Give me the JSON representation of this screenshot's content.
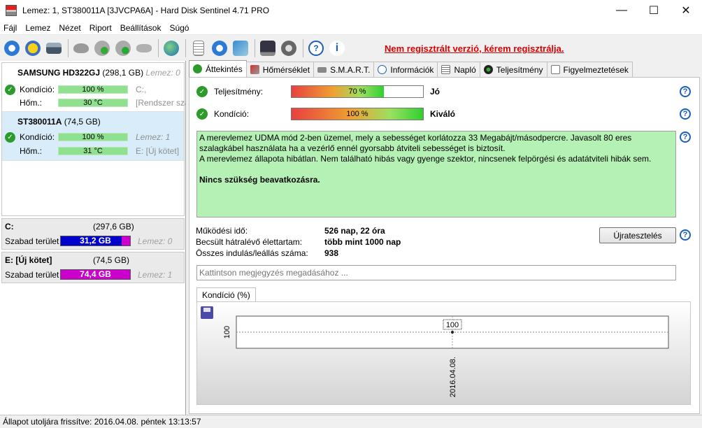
{
  "window": {
    "title": "Lemez: 1, ST380011A [3JVCPA6A]  -  Hard Disk Sentinel 4.71 PRO",
    "min": "—",
    "max": "☐",
    "close": "✕"
  },
  "menu": [
    "Fájl",
    "Lemez",
    "Nézet",
    "Riport",
    "Beállítások",
    "Súgó"
  ],
  "toolbar": {
    "register_text": "Nem regisztrált verzió, kérem regisztrálja."
  },
  "disks": [
    {
      "name": "SAMSUNG HD322GJ",
      "size": "(298,1 GB)",
      "disk_no": "Lemez: 0",
      "condition_label": "Kondíció:",
      "condition_value": "100 %",
      "temp_label": "Hőm.:",
      "temp_value": "30 °C",
      "drive": "C:,",
      "drive_label": "[Rendszer szá"
    },
    {
      "name": "ST380011A",
      "size": "(74,5 GB)",
      "disk_no": "",
      "condition_label": "Kondíció:",
      "condition_value": "100 %",
      "temp_label": "Hőm.:",
      "temp_value": "31 °C",
      "drive": "Lemez: 1",
      "drive_label": "E: [Új kötet]"
    }
  ],
  "volumes": [
    {
      "name": "C:",
      "size": "(297,6 GB)",
      "free_label": "Szabad terület",
      "free_value": "31,2 GB",
      "disk": "Lemez: 0",
      "color": "#0000cc"
    },
    {
      "name": "E: [Új kötet]",
      "size": "(74,5 GB)",
      "free_label": "Szabad terület",
      "free_value": "74,4 GB",
      "disk": "Lemez: 1",
      "color": "#cc00cc"
    }
  ],
  "tabs": [
    "Áttekintés",
    "Hőmérséklet",
    "S.M.A.R.T.",
    "Információk",
    "Napló",
    "Teljesítmény",
    "Figyelmeztetések"
  ],
  "overview": {
    "performance_label": "Teljesítmény:",
    "performance_value": "70 %",
    "performance_pct": 70,
    "performance_word": "Jó",
    "condition_label": "Kondíció:",
    "condition_value": "100 %",
    "condition_pct": 100,
    "condition_word": "Kiváló",
    "help": "?",
    "description_lines": [
      "A merevlemez UDMA mód 2-ben üzemel, mely a sebességet korlátozza 33 Megabájt/másodpercre. Javasolt 80 eres",
      "szalagkábel használata ha a vezérlő ennél gyorsabb átviteli sebességet is biztosít.",
      "A merevlemez állapota hibátlan. Nem található hibás vagy gyenge szektor, nincsenek felpörgési és adatátviteli hibák sem."
    ],
    "description_strong": "Nincs szükség beavatkozásra.",
    "stats": [
      {
        "label": "Működési idő:",
        "value": "526 nap, 22 óra"
      },
      {
        "label": "Becsült hátralévő élettartam:",
        "value": "több mint 1000 nap"
      },
      {
        "label": "Összes indulás/leállás száma:",
        "value": "938"
      }
    ],
    "reset_label": "Újratesztelés",
    "note_placeholder": "Kattintson megjegyzés megadásához ..."
  },
  "chart_tab": "Kondíció  (%)",
  "chart_data": {
    "type": "line",
    "x": [
      "2016.04.08."
    ],
    "series": [
      {
        "values": [
          100
        ]
      }
    ],
    "ytick": "100",
    "data_label": "100",
    "ylim": [
      99,
      101
    ],
    "grid": true
  },
  "status": {
    "text": "Állapot utoljára frissítve: 2016.04.08. péntek 13:13:57"
  },
  "colors": {
    "accent": "#1c5fb8",
    "ok_green": "#2c9b2c",
    "description_bg": "#b5f0b5",
    "register_red": "#dd0000"
  }
}
